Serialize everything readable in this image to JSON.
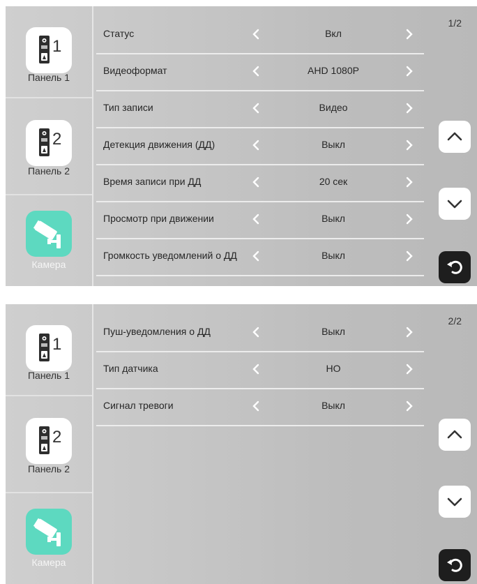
{
  "screens": [
    {
      "page_indicator": "1/2",
      "sidebar": {
        "panel1": {
          "label": "Панель 1",
          "number": "1"
        },
        "panel2": {
          "label": "Панель 2",
          "number": "2"
        },
        "camera": {
          "label": "Камера"
        }
      },
      "rows": [
        {
          "label": "Статус",
          "value": "Вкл"
        },
        {
          "label": "Видеоформат",
          "value": "AHD 1080P"
        },
        {
          "label": "Тип записи",
          "value": "Видео"
        },
        {
          "label": "Детекция движения (ДД)",
          "value": "Выкл"
        },
        {
          "label": "Время записи при ДД",
          "value": "20 сек"
        },
        {
          "label": "Просмотр при движении",
          "value": "Выкл"
        },
        {
          "label": "Громкость уведомлений о ДД",
          "value": "Выкл"
        }
      ]
    },
    {
      "page_indicator": "2/2",
      "sidebar": {
        "panel1": {
          "label": "Панель 1",
          "number": "1"
        },
        "panel2": {
          "label": "Панель 2",
          "number": "2"
        },
        "camera": {
          "label": "Камера"
        }
      },
      "rows": [
        {
          "label": "Пуш-уведомления о ДД",
          "value": "Выкл"
        },
        {
          "label": "Тип датчика",
          "value": "НО"
        },
        {
          "label": "Сигнал тревоги",
          "value": "Выкл"
        }
      ]
    }
  ],
  "icons": {
    "panel": "doorbell-panel-icon",
    "camera": "cctv-camera-icon",
    "arrow_left": "chevron-left-icon",
    "arrow_right": "chevron-right-icon",
    "scroll_up": "chevron-up-icon",
    "scroll_down": "chevron-down-icon",
    "back": "back-arrow-icon"
  },
  "colors": {
    "camera_accent": "#5dd9c0",
    "back_button": "#1e1e1e"
  }
}
